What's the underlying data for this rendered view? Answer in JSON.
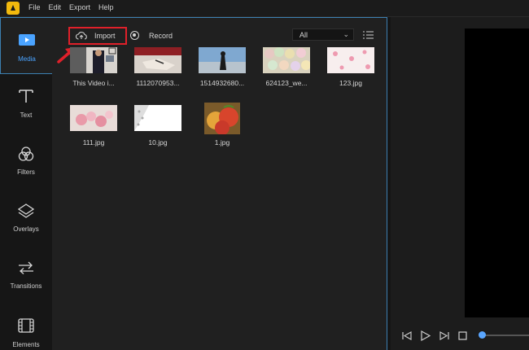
{
  "menu": {
    "file": "File",
    "edit": "Edit",
    "export": "Export",
    "help": "Help"
  },
  "sidebar": {
    "items": [
      {
        "label": "Media"
      },
      {
        "label": "Text"
      },
      {
        "label": "Filters"
      },
      {
        "label": "Overlays"
      },
      {
        "label": "Transitions"
      },
      {
        "label": "Elements"
      }
    ]
  },
  "toolbar": {
    "import_label": "Import",
    "record_label": "Record",
    "filter_value": "All"
  },
  "media": {
    "items": [
      {
        "label": "This Video i..."
      },
      {
        "label": "1112070953..."
      },
      {
        "label": "1514932680..."
      },
      {
        "label": "624123_we..."
      },
      {
        "label": "123.jpg"
      },
      {
        "label": "111.jpg"
      },
      {
        "label": "10.jpg"
      },
      {
        "label": "1.jpg"
      }
    ]
  },
  "colors": {
    "accent": "#3c7fb1",
    "highlight": "#e0202a",
    "active_text": "#4aa3ff",
    "seek": "#5aa6ff"
  }
}
